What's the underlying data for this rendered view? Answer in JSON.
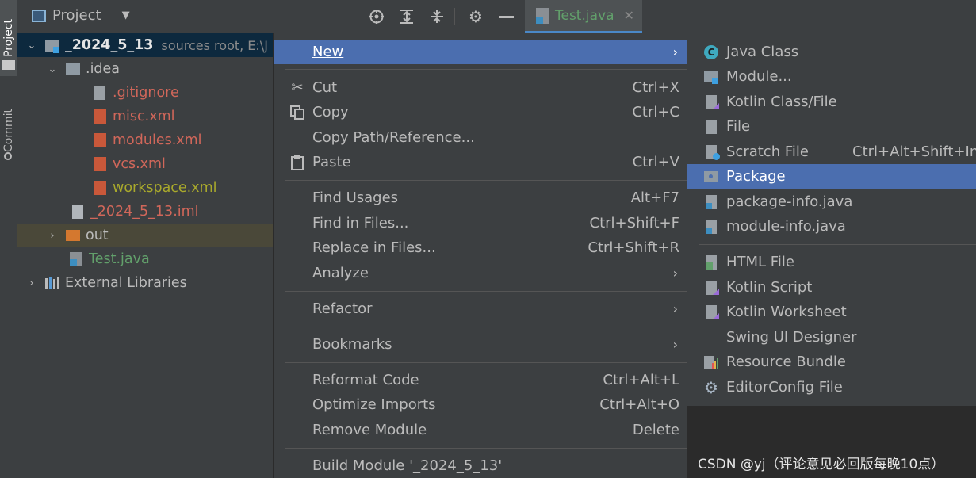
{
  "sidebar": {
    "project_tab": "Project",
    "commit_tab": "Commit"
  },
  "toolbar": {
    "title": "Project",
    "editor_tab": "Test.java"
  },
  "tree": {
    "root": {
      "name": "_2024_5_13",
      "hint": "sources root,  E:\\J"
    },
    "idea": ".idea",
    "gitignore": ".gitignore",
    "misc": "misc.xml",
    "modules": "modules.xml",
    "vcs": "vcs.xml",
    "workspace": "workspace.xml",
    "iml": "_2024_5_13.iml",
    "out": "out",
    "test": "Test.java",
    "external": "External Libraries"
  },
  "menu": {
    "new": "New",
    "cut": {
      "label": "Cut",
      "shortcut": "Ctrl+X"
    },
    "copy": {
      "label": "Copy",
      "shortcut": "Ctrl+C"
    },
    "copy_path": "Copy Path/Reference...",
    "paste": {
      "label": "Paste",
      "shortcut": "Ctrl+V"
    },
    "find_usages": {
      "label": "Find Usages",
      "shortcut": "Alt+F7"
    },
    "find_in_files": {
      "label": "Find in Files...",
      "shortcut": "Ctrl+Shift+F"
    },
    "replace_in_files": {
      "label": "Replace in Files...",
      "shortcut": "Ctrl+Shift+R"
    },
    "analyze": "Analyze",
    "refactor": "Refactor",
    "bookmarks": "Bookmarks",
    "reformat": {
      "label": "Reformat Code",
      "shortcut": "Ctrl+Alt+L"
    },
    "optimize": {
      "label": "Optimize Imports",
      "shortcut": "Ctrl+Alt+O"
    },
    "remove_module": {
      "label": "Remove Module",
      "shortcut": "Delete"
    },
    "build_module": "Build Module '_2024_5_13'"
  },
  "submenu": {
    "java_class": "Java Class",
    "module": "Module...",
    "kotlin_class": "Kotlin Class/File",
    "file": "File",
    "scratch": {
      "label": "Scratch File",
      "shortcut": "Ctrl+Alt+Shift+Ins"
    },
    "package": "Package",
    "package_info": "package-info.java",
    "module_info": "module-info.java",
    "html_file": "HTML File",
    "kotlin_script": "Kotlin Script",
    "kotlin_worksheet": "Kotlin Worksheet",
    "swing_designer": "Swing UI Designer",
    "resource_bundle": "Resource Bundle",
    "editorconfig": "EditorConfig File"
  },
  "watermark": "CSDN @yj（评论意见必回版每晚10点）",
  "colors": {
    "selection": "#4b6eaf",
    "ignored_file": "#d1675a",
    "workspace_file": "#a9a92c",
    "new_file": "#62a06b"
  }
}
